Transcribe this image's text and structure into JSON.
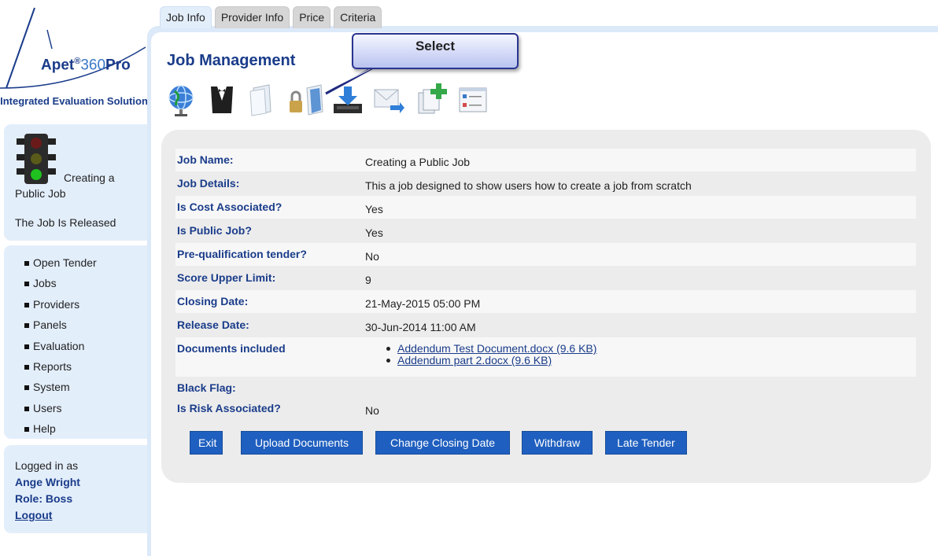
{
  "brand": {
    "name": "Apet",
    "reg": "®",
    "number": "360",
    "suffix": "Pro",
    "tagline": "Integrated Evaluation Solution"
  },
  "status": {
    "job_name": "Creating a Public Job",
    "state": "The Job Is Released"
  },
  "sidebar": {
    "items": [
      {
        "label": "Open Tender"
      },
      {
        "label": "Jobs"
      },
      {
        "label": "Providers"
      },
      {
        "label": "Panels"
      },
      {
        "label": "Evaluation"
      },
      {
        "label": "Reports"
      },
      {
        "label": "System"
      },
      {
        "label": "Users"
      },
      {
        "label": "Help"
      }
    ]
  },
  "login": {
    "prefix": "Logged in as",
    "user": "Ange Wright",
    "role": "Role: Boss",
    "logout": "Logout"
  },
  "tabs": [
    {
      "label": "Job Info"
    },
    {
      "label": "Provider Info"
    },
    {
      "label": "Price"
    },
    {
      "label": "Criteria"
    }
  ],
  "main": {
    "title": "Job Management",
    "callout": "Select",
    "toolbar_icons": [
      "globe-icon",
      "tuxedo-icon",
      "document-icon",
      "lock-document-icon",
      "download-tray-icon",
      "email-forward-icon",
      "copy-add-icon",
      "form-list-icon"
    ]
  },
  "details": {
    "rows": [
      {
        "label": "Job Name:",
        "value": "Creating a Public Job"
      },
      {
        "label": "Job Details:",
        "value": "This a job designed to show users how to create a job from scratch"
      },
      {
        "label": "Is Cost Associated?",
        "value": "Yes"
      },
      {
        "label": "Is Public Job?",
        "value": "Yes"
      },
      {
        "label": "Pre-qualification tender?",
        "value": "No"
      },
      {
        "label": "Score Upper Limit:",
        "value": "9"
      },
      {
        "label": "Closing Date:",
        "value": "21-May-2015 05:00 PM"
      },
      {
        "label": "Release Date:",
        "value": "30-Jun-2014 11:00 AM"
      },
      {
        "label": "Documents included",
        "value": ""
      },
      {
        "label": "Black Flag:",
        "value": ""
      },
      {
        "label": "Is Risk Associated?",
        "value": "No"
      }
    ],
    "documents": [
      "Addendum Test Document.docx (9.6 KB)",
      "Addendum part 2.docx (9.6 KB)"
    ]
  },
  "buttons": {
    "exit": "Exit",
    "upload": "Upload Documents",
    "change_closing": "Change Closing Date",
    "withdraw": "Withdraw",
    "late": "Late Tender"
  },
  "colors": {
    "brand_blue": "#1a3c8a",
    "button_blue": "#1f5fbf",
    "sidebar_bg": "#e3eefb",
    "panel_bg": "#ececec"
  }
}
